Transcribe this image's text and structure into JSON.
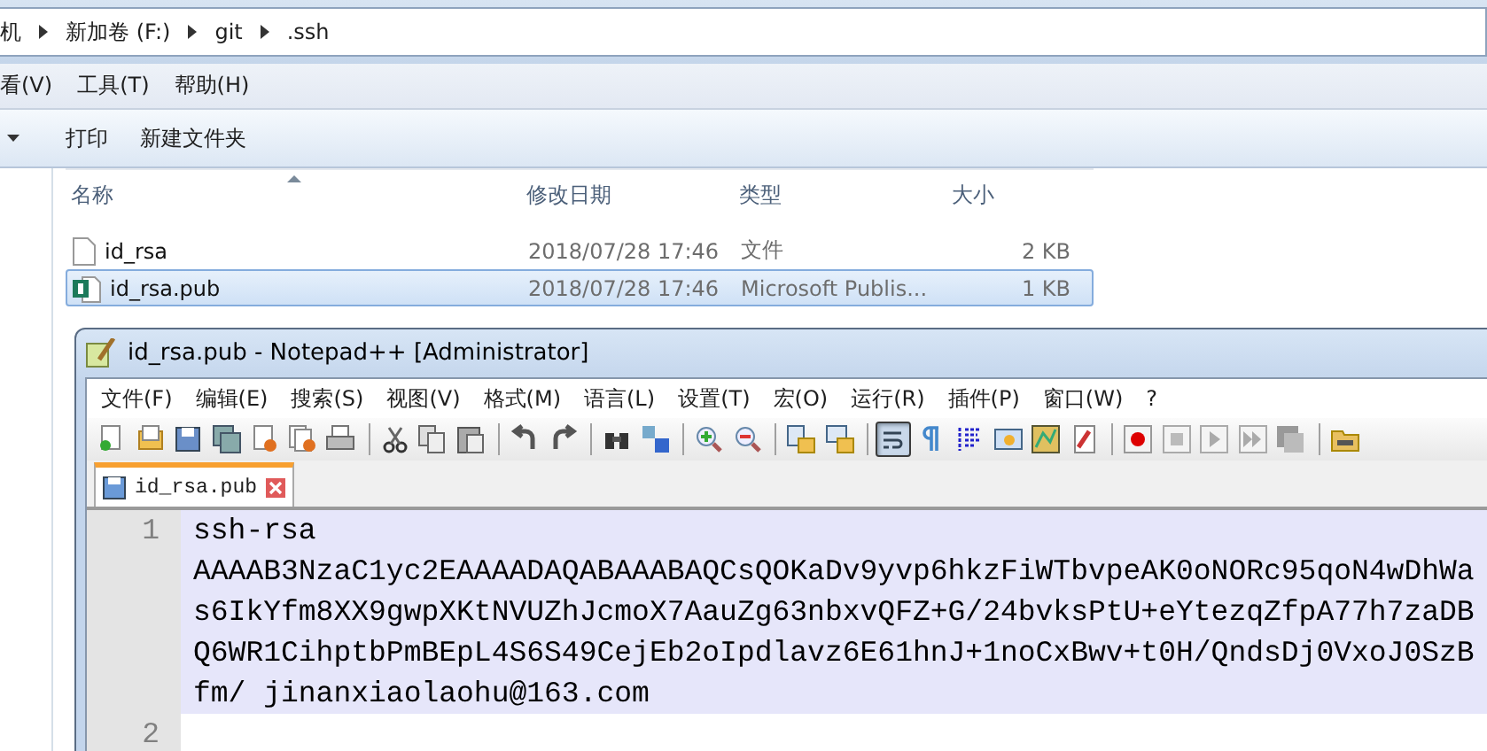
{
  "explorer": {
    "breadcrumbs": [
      "机",
      "新加卷 (F:)",
      "git",
      ".ssh"
    ],
    "menu": [
      "看(V)",
      "工具(T)",
      "帮助(H)"
    ],
    "toolbar": [
      "打印",
      "新建文件夹"
    ],
    "columns": [
      "名称",
      "修改日期",
      "类型",
      "大小"
    ],
    "files": [
      {
        "name": "id_rsa",
        "kind": "file",
        "modified": "2018/07/28 17:46",
        "type": "文件",
        "size": "2 KB",
        "selected": false
      },
      {
        "name": "id_rsa.pub",
        "kind": "publisher",
        "modified": "2018/07/28 17:46",
        "type": "Microsoft Publis...",
        "size": "1 KB",
        "selected": true
      }
    ]
  },
  "notepad": {
    "title": "id_rsa.pub - Notepad++ [Administrator]",
    "menu": [
      "文件(F)",
      "编辑(E)",
      "搜索(S)",
      "视图(V)",
      "格式(M)",
      "语言(L)",
      "设置(T)",
      "宏(O)",
      "运行(R)",
      "插件(P)",
      "窗口(W)",
      "?"
    ],
    "toolbar": [
      {
        "kind": "new",
        "pressed": false
      },
      {
        "kind": "open",
        "pressed": false
      },
      {
        "kind": "save",
        "pressed": false
      },
      {
        "kind": "saveall",
        "pressed": false
      },
      {
        "kind": "close",
        "pressed": false
      },
      {
        "kind": "closeall",
        "pressed": false
      },
      {
        "kind": "print",
        "pressed": false
      },
      {
        "kind": "sep"
      },
      {
        "kind": "cut",
        "pressed": false
      },
      {
        "kind": "copy",
        "pressed": false
      },
      {
        "kind": "paste",
        "pressed": false
      },
      {
        "kind": "sep"
      },
      {
        "kind": "undo",
        "pressed": false
      },
      {
        "kind": "redo",
        "pressed": false
      },
      {
        "kind": "sep"
      },
      {
        "kind": "find",
        "pressed": false
      },
      {
        "kind": "replace",
        "pressed": false
      },
      {
        "kind": "sep"
      },
      {
        "kind": "zoomin",
        "pressed": false
      },
      {
        "kind": "zoomout",
        "pressed": false
      },
      {
        "kind": "sep"
      },
      {
        "kind": "syncv",
        "pressed": false
      },
      {
        "kind": "synch",
        "pressed": false
      },
      {
        "kind": "sep"
      },
      {
        "kind": "wrap",
        "pressed": true
      },
      {
        "kind": "pilcrow",
        "pressed": false
      },
      {
        "kind": "indent",
        "pressed": false
      },
      {
        "kind": "panel",
        "pressed": false
      },
      {
        "kind": "map",
        "pressed": false
      },
      {
        "kind": "function",
        "pressed": false
      },
      {
        "kind": "sep"
      },
      {
        "kind": "record",
        "pressed": false
      },
      {
        "kind": "stop",
        "pressed": false
      },
      {
        "kind": "play",
        "pressed": false
      },
      {
        "kind": "playmany",
        "pressed": false
      },
      {
        "kind": "savemacro",
        "pressed": false
      },
      {
        "kind": "sep"
      },
      {
        "kind": "folder",
        "pressed": false
      }
    ],
    "tabs": [
      {
        "label": "id_rsa.pub",
        "selected": true
      }
    ],
    "lines": [
      {
        "number": "1",
        "selected": true,
        "rows": [
          "ssh-rsa",
          "AAAAB3NzaC1yc2EAAAADAQABAAABAQCsQOKaDv9yvp6hkzFiWTbvpeAK0oNORc95qoN4wDhWa",
          "s6IkYfm8XX9gwpXKtNVUZhJcmoX7AauZg63nbxvQFZ+G/24bvksPtU+eYtezqZfpA77h7zaDB",
          "Q6WR1CihptbPmBEpL4S6S49CejEb2oIpdlavz6E61hnJ+1noCxBwv+t0H/QndsDj0VxoJ0SzB",
          "fm/ jinanxiaolaohu@163.com"
        ]
      },
      {
        "number": "2",
        "selected": false
      }
    ]
  }
}
